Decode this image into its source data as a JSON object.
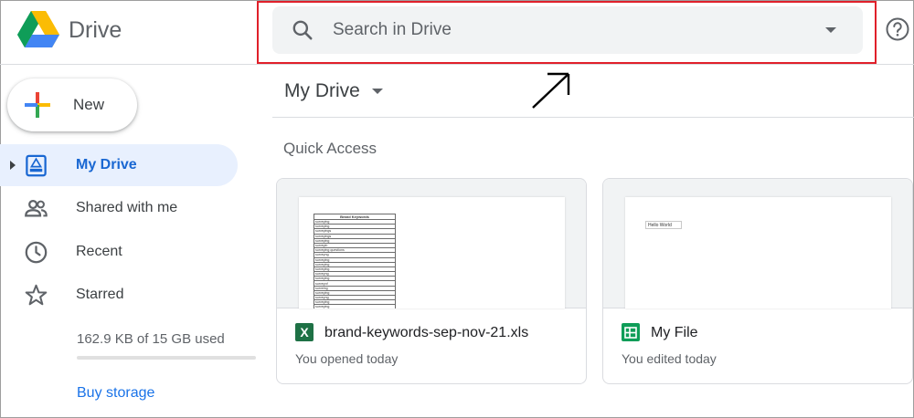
{
  "header": {
    "app_name": "Drive",
    "search_placeholder": "Search in Drive",
    "search_value": ""
  },
  "sidebar": {
    "new_label": "New",
    "items": [
      {
        "label": "My Drive",
        "icon": "my-drive-icon",
        "active": true
      },
      {
        "label": "Shared with me",
        "icon": "shared-people-icon",
        "active": false
      },
      {
        "label": "Recent",
        "icon": "clock-icon",
        "active": false
      },
      {
        "label": "Starred",
        "icon": "star-icon",
        "active": false
      }
    ],
    "storage_text": "162.9 KB of 15 GB used",
    "storage_used_fraction": 1e-05,
    "buy_storage_label": "Buy storage"
  },
  "main": {
    "title": "My Drive",
    "quick_access_label": "Quick Access",
    "files": [
      {
        "name": "brand-keywords-sep-nov-21.xls",
        "activity": "You opened today",
        "icon": "excel-icon",
        "preview": {
          "header": "Brand Keywords",
          "rows": [
            "surveying",
            "surveying",
            "surveyings",
            "surveyings",
            "surveying",
            "surveyin",
            "surveying questions",
            "surveyng",
            "surveying",
            "surveying",
            "surveying",
            "surveyng",
            "surveying",
            "surveyof",
            "surveing",
            "surveying",
            "surveyng",
            "surveying",
            "surveying",
            "surveyinge",
            "surveying"
          ]
        }
      },
      {
        "name": "My File",
        "activity": "You edited today",
        "icon": "google-sheets-icon",
        "preview": {
          "cell_text": "Hello World"
        }
      }
    ]
  },
  "colors": {
    "accent_blue": "#1a73e8",
    "active_bg": "#e8f0fe",
    "highlight_red": "#e0202a",
    "excel_green": "#1e7145",
    "sheets_green": "#0f9d58"
  }
}
